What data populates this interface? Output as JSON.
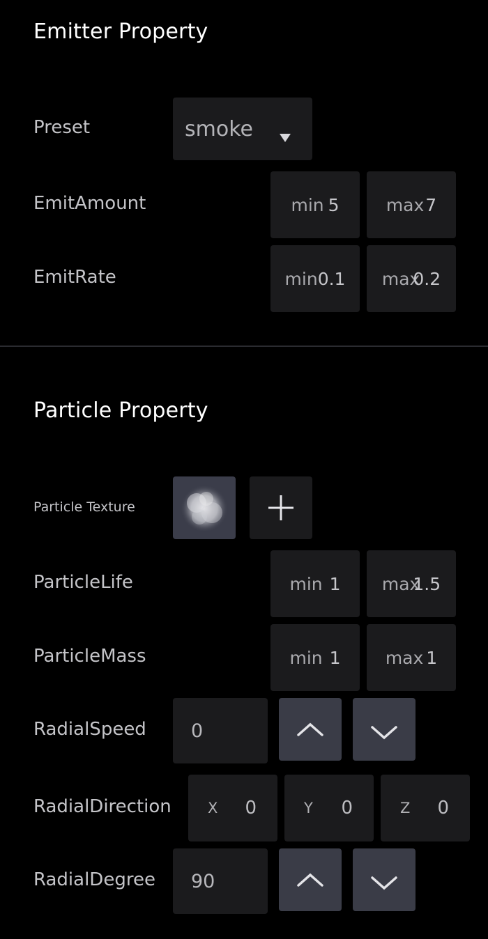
{
  "emitter": {
    "title": "Emitter Property",
    "preset": {
      "label": "Preset",
      "value": "smoke"
    },
    "emit_amount": {
      "label": "EmitAmount",
      "min_prefix": "min",
      "min_value": "5",
      "max_prefix": "max",
      "max_value": "7"
    },
    "emit_rate": {
      "label": "EmitRate",
      "min_prefix": "min",
      "min_value": "0.1",
      "max_prefix": "max",
      "max_value": "0.2"
    }
  },
  "particle": {
    "title": "Particle Property",
    "texture": {
      "label": "Particle Texture"
    },
    "life": {
      "label": "ParticleLife",
      "min_prefix": "min",
      "min_value": "1",
      "max_prefix": "max",
      "max_value": "1.5"
    },
    "mass": {
      "label": "ParticleMass",
      "min_prefix": "min",
      "min_value": "1",
      "max_prefix": "max",
      "max_value": "1"
    },
    "radial_speed": {
      "label": "RadialSpeed",
      "value": "0"
    },
    "radial_direction": {
      "label": "RadialDirection",
      "x_label": "X",
      "x_value": "0",
      "y_label": "Y",
      "y_value": "0",
      "z_label": "Z",
      "z_value": "0"
    },
    "radial_degree": {
      "label": "RadialDegree",
      "value": "90"
    }
  },
  "icons": {
    "dropdown": "caret-down-icon",
    "add": "plus-icon",
    "increment": "chevron-up-icon",
    "decrement": "chevron-down-icon"
  },
  "colors": {
    "background": "#000000",
    "field": "#1b1b1d",
    "button": "#3a3c47",
    "divider": "#2a2b30"
  }
}
